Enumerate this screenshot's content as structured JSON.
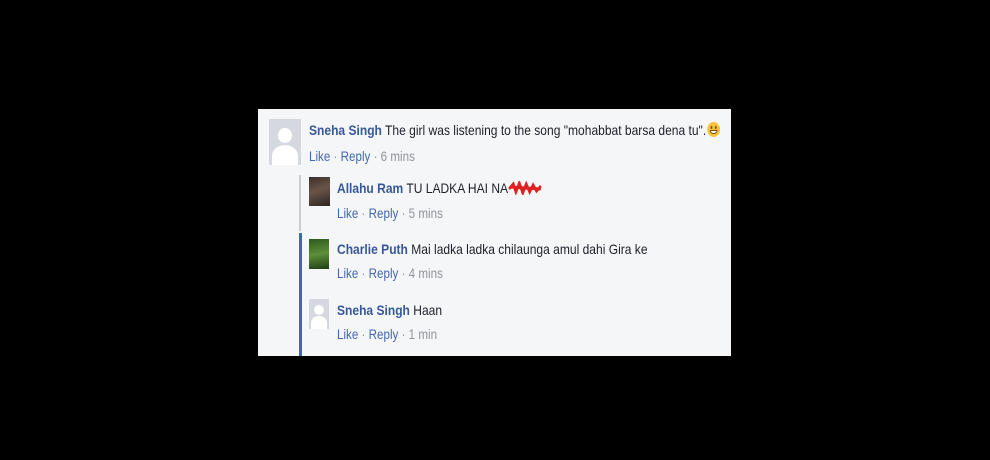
{
  "comments": [
    {
      "author": "Sneha Singh",
      "text": "The girl was listening to the song \"mohabbat barsa dena tu\".",
      "like": "Like",
      "reply": "Reply",
      "time": "6 mins",
      "avatar": "default-avatar-icon"
    }
  ],
  "replies": [
    {
      "author": "Allahu Ram",
      "text": "TU LADKA HAI NA",
      "like": "Like",
      "reply": "Reply",
      "time": "5 mins",
      "avatar": "profile-photo",
      "censor_color": "#e0211f"
    },
    {
      "author": "Charlie Puth",
      "text": "Mai ladka ladka chilaunga amul dahi Gira ke",
      "like": "Like",
      "reply": "Reply",
      "time": "4 mins",
      "avatar": "profile-photo"
    },
    {
      "author": "Sneha Singh",
      "text": "Haan",
      "like": "Like",
      "reply": "Reply",
      "time": "1 min",
      "avatar": "default-avatar-icon"
    }
  ],
  "separator": "·",
  "colors": {
    "author": "#365899",
    "link": "#4267b2",
    "meta": "#90949c",
    "card_bg": "#f5f6f8",
    "reply_rail_active": "#4267b2"
  }
}
